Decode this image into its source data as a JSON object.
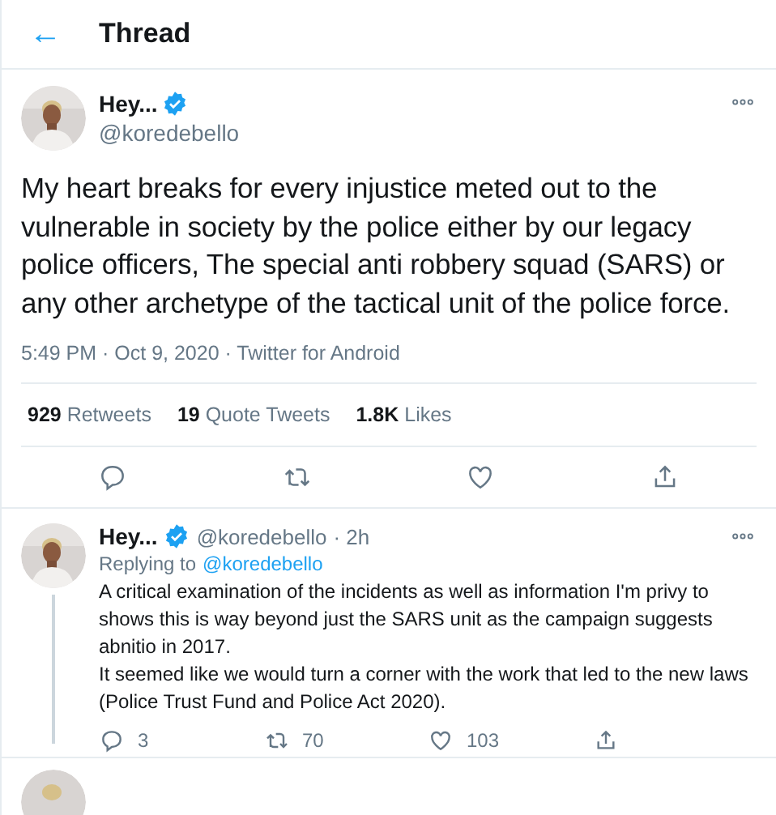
{
  "header": {
    "back_icon": "←",
    "title": "Thread"
  },
  "tweet": {
    "name": "Hey...",
    "verified": true,
    "handle": "@koredebello",
    "text": "My heart breaks for every injustice meted out to the vulnerable in society by the police either by our legacy police officers, The special anti robbery squad (SARS) or any other archetype of the tactical unit of the police force.",
    "meta": "5:49 PM · Oct 9, 2020 · Twitter for Android",
    "stats": [
      {
        "count": "929",
        "label": "Retweets"
      },
      {
        "count": "19",
        "label": "Quote Tweets"
      },
      {
        "count": "1.8K",
        "label": "Likes"
      }
    ]
  },
  "reply": {
    "name": "Hey...",
    "verified": true,
    "handle": "@koredebello",
    "time": "· 2h",
    "replying_label": "Replying to",
    "replying_handle": "@koredebello",
    "text": "A critical examination of the incidents as well as information I'm privy to shows this is way beyond just the SARS unit as the campaign suggests abnitio in 2017.\nIt seemed like we would turn a corner with the work that led to the new laws (Police Trust Fund and Police Act 2020).",
    "actions": [
      {
        "kind": "reply",
        "count": "3"
      },
      {
        "kind": "retweet",
        "count": "70"
      },
      {
        "kind": "like",
        "count": "103"
      },
      {
        "kind": "share"
      }
    ]
  }
}
